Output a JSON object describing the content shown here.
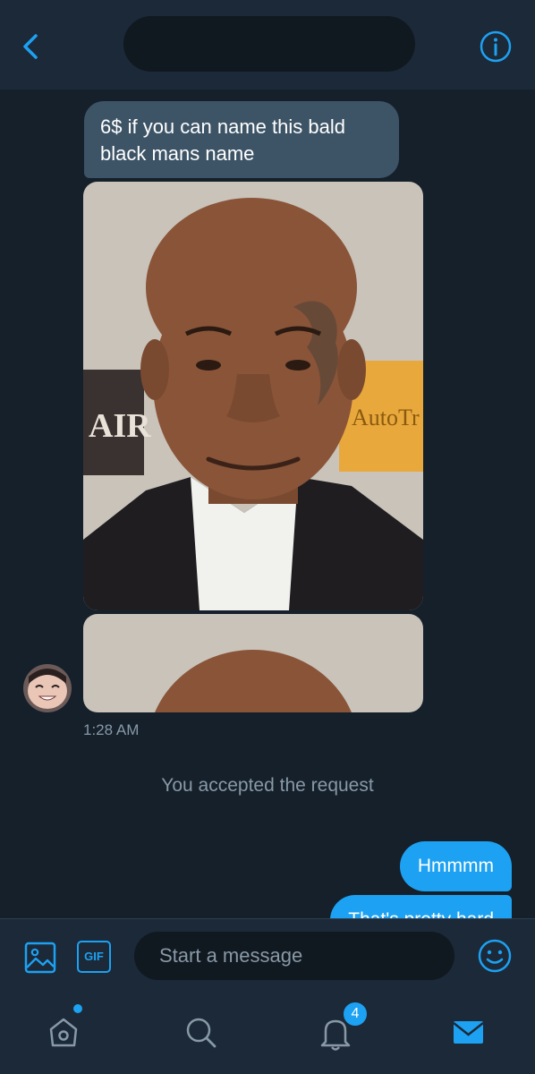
{
  "header": {
    "back_icon": "chevron-left-icon",
    "info_icon": "info-icon"
  },
  "conversation": {
    "incoming_text": "6$ if you can name this bald black mans name",
    "photo_sign_left": "AIR",
    "photo_sign_right": "AutoTr",
    "timestamp": "1:28 AM",
    "system_message": "You accepted the request",
    "outgoing": [
      {
        "text": "Hmmmm"
      },
      {
        "text": "That's pretty hard"
      }
    ]
  },
  "composer": {
    "gif_label": "GIF",
    "placeholder": "Start a message",
    "media_icon": "image-icon",
    "emoji_icon": "emoji-icon"
  },
  "tabbar": {
    "notification_count": "4",
    "tabs": [
      "home-icon",
      "search-icon",
      "bell-icon",
      "mail-icon"
    ]
  },
  "colors": {
    "accent": "#1da1f2",
    "background": "#15202b",
    "bar": "#1c2938",
    "incoming_bubble": "#3d5466",
    "muted_text": "#8899a6"
  }
}
